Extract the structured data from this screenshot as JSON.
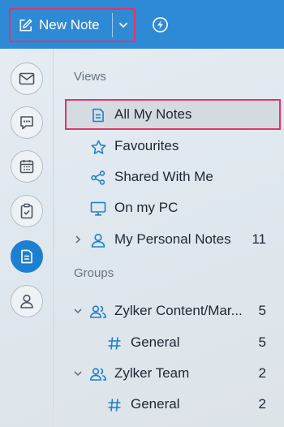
{
  "toolbar": {
    "new_note_label": "New Note",
    "icons": {
      "new_note": "edit-icon",
      "dropdown": "chevron-down-icon",
      "quick": "flash-icon"
    }
  },
  "rail": {
    "items": [
      {
        "icon": "mail-icon"
      },
      {
        "icon": "chat-icon"
      },
      {
        "icon": "calendar-icon"
      },
      {
        "icon": "tasks-icon"
      },
      {
        "icon": "notes-icon",
        "active": true
      },
      {
        "icon": "contacts-icon"
      }
    ]
  },
  "views": {
    "title": "Views",
    "items": [
      {
        "label": "All My Notes",
        "icon": "note-icon",
        "selected": true
      },
      {
        "label": "Favourites",
        "icon": "star-icon"
      },
      {
        "label": "Shared With Me",
        "icon": "share-icon"
      },
      {
        "label": "On my PC",
        "icon": "monitor-icon"
      },
      {
        "label": "My Personal Notes",
        "icon": "user-icon",
        "count": "11"
      }
    ]
  },
  "groups": {
    "title": "Groups",
    "items": [
      {
        "label": "Zylker Content/Mar...",
        "icon": "group-icon",
        "count": "5",
        "children": [
          {
            "label": "General",
            "icon": "hash-icon",
            "count": "5"
          }
        ]
      },
      {
        "label": "Zylker Team",
        "icon": "group-icon",
        "count": "2",
        "children": [
          {
            "label": "General",
            "icon": "hash-icon",
            "count": "2"
          }
        ]
      }
    ]
  },
  "colors": {
    "accent": "#2f8ad6",
    "highlight": "#e2336b",
    "icon": "#1c7fd1"
  }
}
